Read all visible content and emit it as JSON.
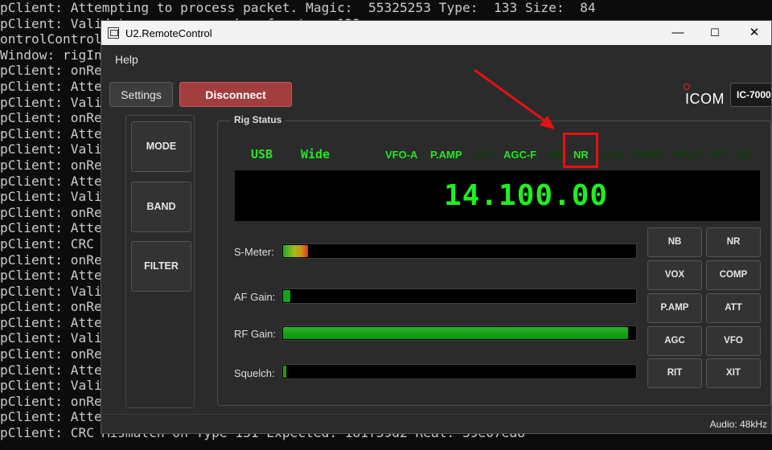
{
  "console": {
    "lines": [
      "pClient: Attempting to process packet. Magic:  55325253 Type:  133 Size:  84",
      "pClient: Validate sequence number for type 133",
      "ontrolControl",
      "Window: rigIn",
      "pClient: onRe",
      "pClient: Atte",
      "pClient: Vali",
      "pClient: onRe",
      "pClient: Atte",
      "pClient: Vali",
      "pClient: onRe",
      "pClient: Atte",
      "pClient: Vali",
      "pClient: onRe",
      "pClient: Atte",
      "pClient: CRC",
      "pClient: onRe",
      "pClient: Atte",
      "pClient: Vali",
      "pClient: onRe",
      "pClient: Atte",
      "pClient: Vali",
      "pClient: onRe",
      "pClient: Atte",
      "pClient: Vali",
      "pClient: onRe",
      "pClient: Atte",
      "pClient: CRC Mismatch on Type 131 Expected: 181f39d2 Real: 39e07ea8"
    ]
  },
  "window": {
    "title": "U2.RemoteControl",
    "minimize": "—",
    "maximize": "☐",
    "close": "✕"
  },
  "menu": {
    "help": "Help"
  },
  "toolbar": {
    "settings": "Settings",
    "disconnect": "Disconnect",
    "logo": "ICOM",
    "model": "IC-7000"
  },
  "side_buttons": {
    "mode": "MODE",
    "band": "BAND",
    "filter": "FILTER"
  },
  "rig_status": {
    "title": "Rig Status",
    "indicators": {
      "mode": "USB",
      "filter": "Wide",
      "vfo": "VFO-A",
      "pamp": "P.AMP",
      "att": "ATT",
      "agc": "AGC-F",
      "nb": "NB",
      "nr": "NR",
      "vox": "VOX",
      "comp": "COMP",
      "split": "SPLIT",
      "rit": "RIT",
      "xit": "XIT"
    },
    "frequency": "14.100.00"
  },
  "meters": {
    "smeter_label": "S-Meter:",
    "af_label": "AF Gain:",
    "rf_label": "RF Gain:",
    "squelch_label": "Squelch:",
    "smeter_level": 0.07,
    "af_level": 0.02,
    "rf_level": 0.98,
    "squelch_level": 0.01
  },
  "function_buttons": {
    "nb": "NB",
    "nr": "NR",
    "vox": "VOX",
    "comp": "COMP",
    "pamp": "P.AMP",
    "att": "ATT",
    "agc": "AGC",
    "vfo": "VFO",
    "rit": "RIT",
    "xit": "XIT"
  },
  "statusbar": {
    "audio": "Audio: 48kHz"
  },
  "colors": {
    "indicator_on": "#22e622",
    "indicator_off": "#0a3f0a",
    "disconnect": "#a33e3e",
    "annotation": "#e81010"
  }
}
